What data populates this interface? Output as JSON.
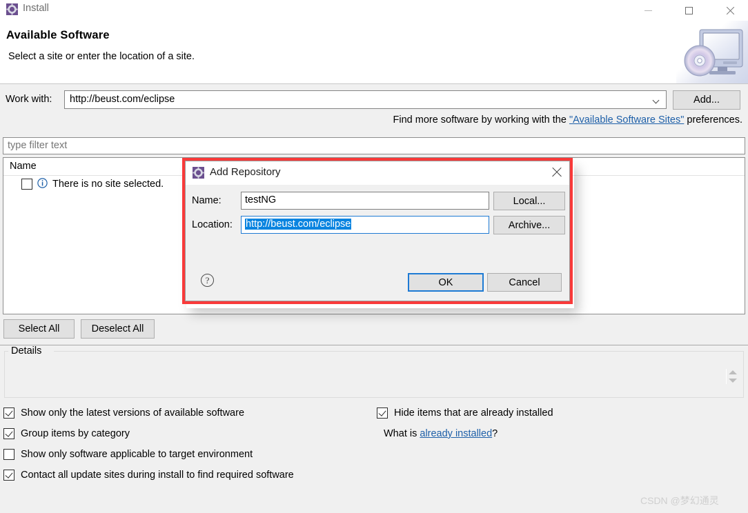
{
  "window": {
    "title": "Install",
    "icon": "eclipse-gear-icon",
    "controls": {
      "minimize": "minimize-icon",
      "maximize": "maximize-icon",
      "close": "close-icon"
    }
  },
  "wizard": {
    "title": "Available Software",
    "subtitle": "Select a site or enter the location of a site.",
    "banner_icon": "monitor-cd-icon"
  },
  "work_with": {
    "label": "Work with:",
    "value": "http://beust.com/eclipse",
    "add_button": "Add...",
    "hint_prefix": "Find more software by working with the ",
    "hint_link": "\"Available Software Sites\"",
    "hint_suffix": " preferences."
  },
  "filter": {
    "placeholder": "type filter text",
    "value": ""
  },
  "tree": {
    "column_header": "Name",
    "rows": [
      {
        "label": "There is no site selected.",
        "checked": false,
        "icon": "info-icon"
      }
    ]
  },
  "selection_buttons": {
    "select_all": "Select All",
    "deselect_all": "Deselect All"
  },
  "details": {
    "legend": "Details",
    "content": "",
    "spinner_icon": "spinner-up-down-icon"
  },
  "options": [
    {
      "label": "Show only the latest versions of available software",
      "checked": true
    },
    {
      "label": "Group items by category",
      "checked": true
    },
    {
      "label": "Show only software applicable to target environment",
      "checked": false
    },
    {
      "label": "Contact all update sites during install to find required software",
      "checked": true
    },
    {
      "label": "Hide items that are already installed",
      "checked": true
    }
  ],
  "what_is": {
    "prefix": "What is ",
    "link": "already installed",
    "suffix": "?"
  },
  "modal": {
    "title": "Add Repository",
    "icon": "eclipse-gear-icon",
    "close_icon": "close-icon",
    "name_label": "Name:",
    "name_value": "testNG",
    "location_label": "Location:",
    "location_value": "http://beust.com/eclipse",
    "local_button": "Local...",
    "archive_button": "Archive...",
    "help_icon": "?",
    "ok_button": "OK",
    "cancel_button": "Cancel",
    "highlight_color": "#f93a3a",
    "focus_color": "#1d7ad4",
    "selection_color": "#0a84e0"
  },
  "watermark": "CSDN @梦幻通灵"
}
